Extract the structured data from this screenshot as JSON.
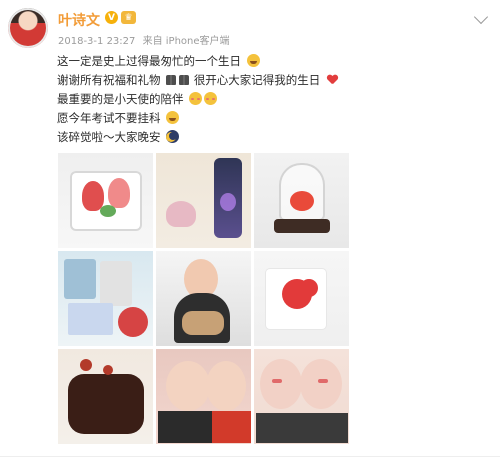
{
  "user": {
    "name": "叶诗文",
    "verified_badge": "V",
    "member_badge": "♛"
  },
  "post": {
    "timestamp": "2018-3-1 23:27",
    "source": "来自 iPhone客户端",
    "lines": [
      "这一定是史上过得最匆忙的一个生日",
      "谢谢所有祝福和礼物",
      "很开心大家记得我的生日",
      "最重要的是小天使的陪伴",
      "愿今年考试不要挂科",
      "该碎觉啦～大家晚安"
    ]
  },
  "icons": {
    "avatar": "profile-photo",
    "verified": "verified-badge-icon",
    "member": "crown-badge-icon",
    "menu": "chevron-down-icon"
  },
  "colors": {
    "username": "#f29c38",
    "badge": "#f6b10b",
    "text": "#2b2b2b",
    "meta": "#9b9b9b"
  }
}
